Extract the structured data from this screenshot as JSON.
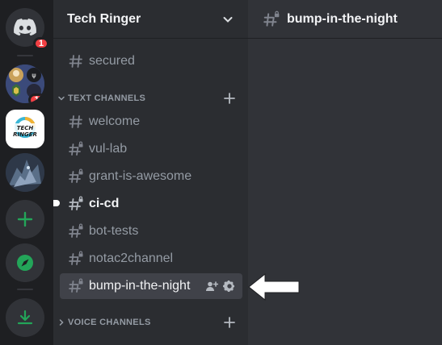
{
  "server_rail": {
    "home_badge": "1",
    "group_badge": "11",
    "tech_ringer_logo_text": "TECH RINGER"
  },
  "sidebar": {
    "server_name": "Tech Ringer",
    "top_channel": "secured",
    "text_category": "TEXT CHANNELS",
    "voice_category": "VOICE CHANNELS",
    "channels": [
      "welcome",
      "vul-lab",
      "grant-is-awesome",
      "ci-cd",
      "bot-tests",
      "notac2channel",
      "bump-in-the-night"
    ]
  },
  "main": {
    "channel_title": "bump-in-the-night"
  },
  "colors": {
    "accent_green": "#23a559",
    "badge_red": "#f23f43",
    "blurple": "#5865f2"
  }
}
